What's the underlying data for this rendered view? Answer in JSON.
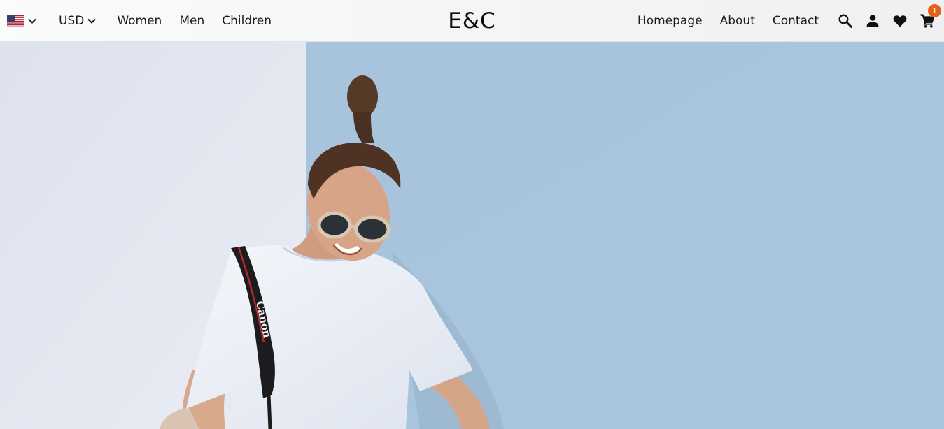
{
  "header": {
    "region_flag_icon": "us-flag-icon",
    "currency": "USD",
    "left_links": [
      "Women",
      "Men",
      "Children"
    ],
    "logo": "E&C",
    "right_links": [
      "Homepage",
      "About",
      "Contact"
    ],
    "cart_count": "1",
    "icons": [
      "search-icon",
      "user-icon",
      "heart-icon",
      "cart-icon"
    ]
  },
  "hero": {
    "strap_text": "Canon"
  },
  "colors": {
    "wall_left": "#e4e8f0",
    "wall_right": "#a9c7df",
    "badge": "#e5601b"
  }
}
